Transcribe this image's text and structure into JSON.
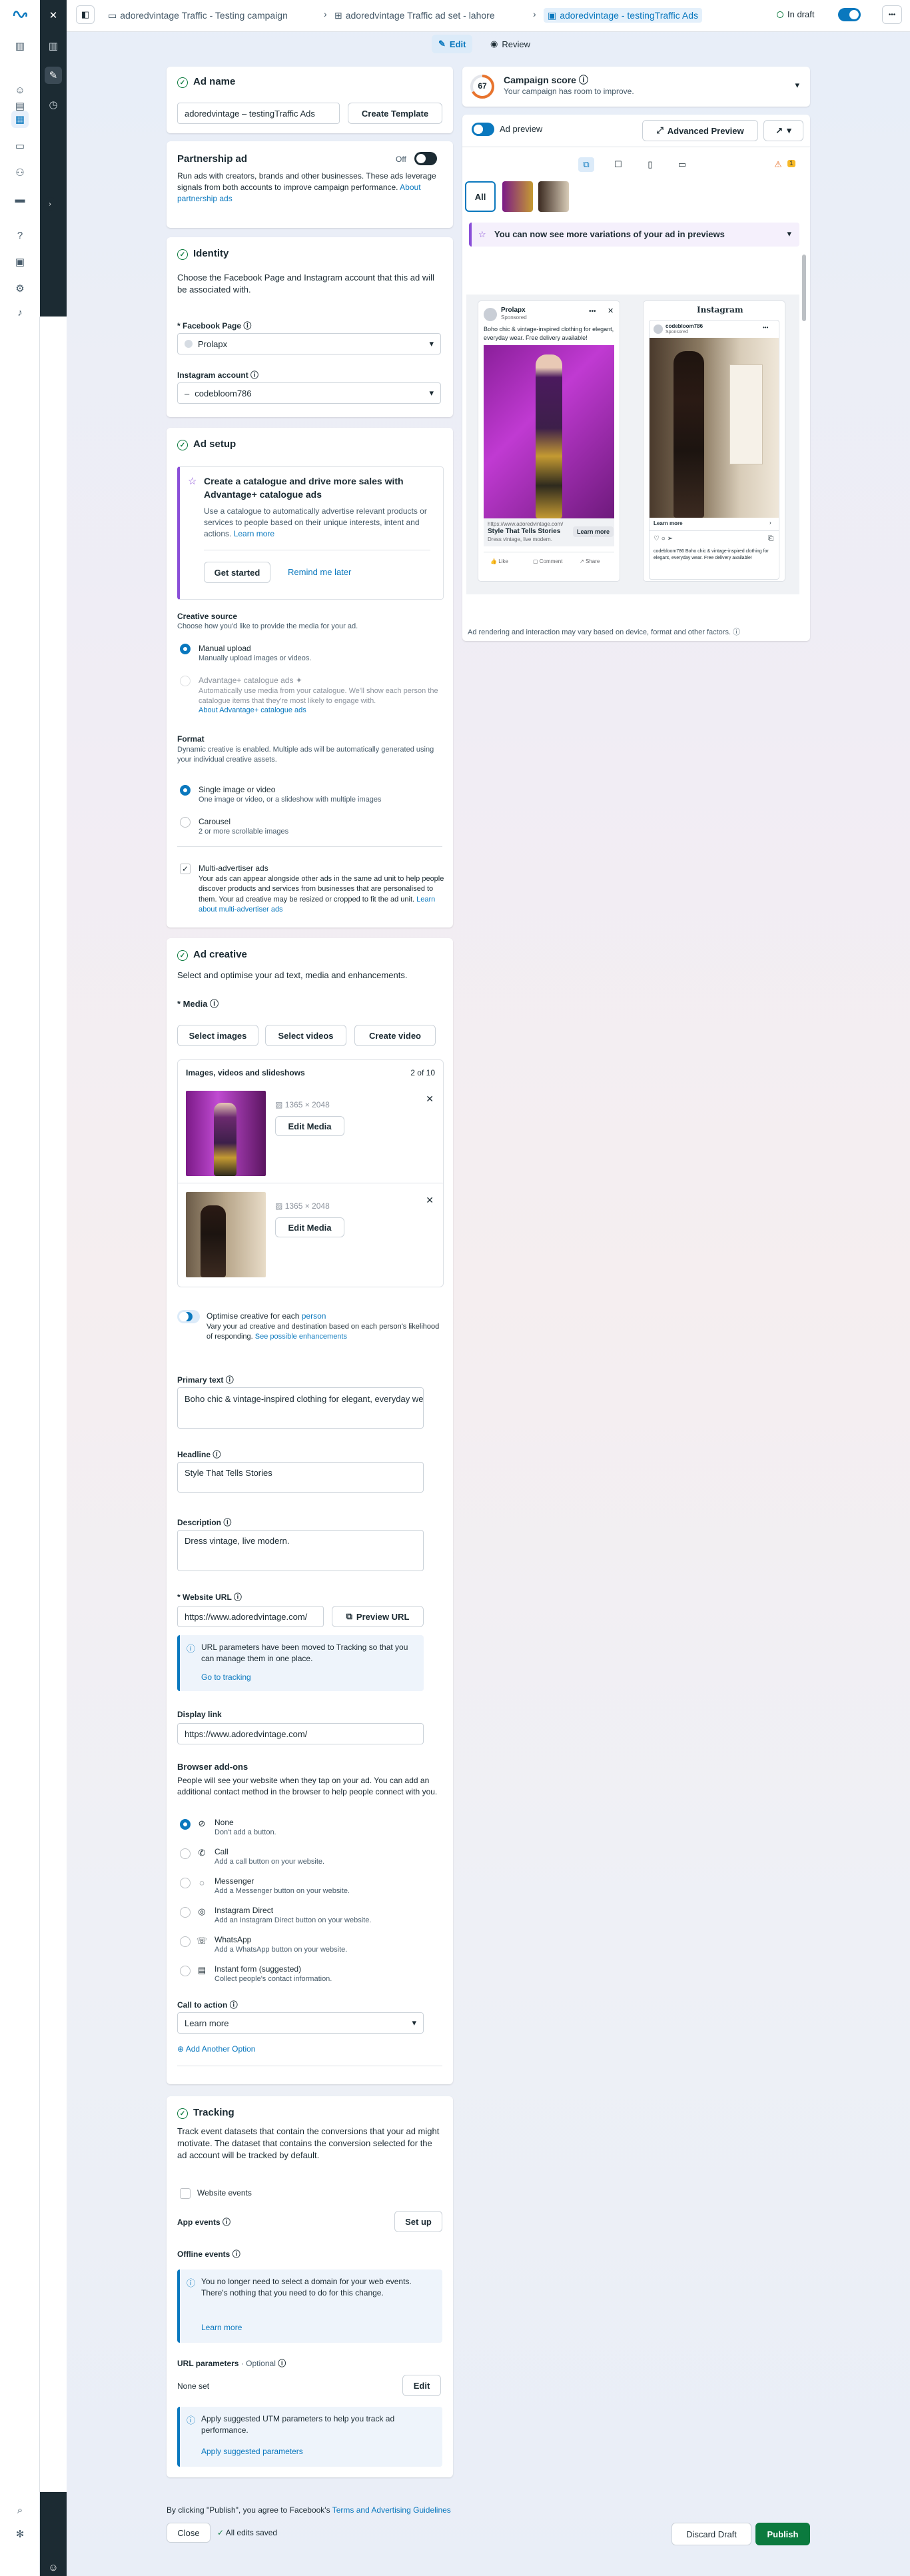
{
  "nav": {
    "icons": [
      "close-icon",
      "chart-icon",
      "smiley-icon",
      "ads-grid-icon",
      "pages-icon",
      "people-icon",
      "billing-icon",
      "expand-icon",
      "help-icon",
      "briefcase-icon",
      "settings-icon",
      "bell-icon",
      "search-icon",
      "bug-icon",
      "edit-icon",
      "clock-icon"
    ]
  },
  "header": {
    "crumb1": "adoredvintage Traffic - Testing campaign",
    "crumb2": "adoredvintage Traffic ad set - lahore",
    "crumb3": "adoredvintage - testingTraffic Ads",
    "status": "In draft",
    "more": "•••"
  },
  "tabs": {
    "edit": "Edit",
    "review": "Review"
  },
  "ad_name": {
    "title": "Ad name",
    "value": "adoredvintage – testingTraffic  Ads",
    "template_btn": "Create Template"
  },
  "partnership": {
    "title": "Partnership ad",
    "state": "Off",
    "desc": "Run ads with creators, brands and other businesses. These ads leverage signals from both accounts to improve campaign performance.",
    "link": "About partnership ads"
  },
  "identity": {
    "title": "Identity",
    "desc": "Choose the Facebook Page and Instagram account that this ad will be associated with.",
    "fb_label": "* Facebook Page",
    "fb_value": "Prolapx",
    "ig_label": "Instagram account",
    "ig_value": "codebloom786"
  },
  "ad_setup": {
    "title": "Ad setup",
    "promo_title": "Create a catalogue and drive more sales with Advantage+ catalogue ads",
    "promo_desc": "Use a catalogue to automatically advertise relevant products or services to people based on their unique interests, intent and actions.",
    "promo_link": "Learn more",
    "get_started": "Get started",
    "remind": "Remind me later",
    "cs_title": "Creative source",
    "cs_desc": "Choose how you'd like to provide the media for your ad.",
    "manual": "Manual upload",
    "manual_desc": "Manually upload images or videos.",
    "catalog": "Advantage+ catalogue ads",
    "catalog_desc": "Automatically use media from your catalogue. We'll show each person the catalogue items that they're most likely to engage with.",
    "catalog_link": "About Advantage+ catalogue ads",
    "format_title": "Format",
    "format_desc": "Dynamic creative is enabled. Multiple ads will be automatically generated using your individual creative assets.",
    "single": "Single image or video",
    "single_desc": "One image or video, or a slideshow with multiple images",
    "carousel": "Carousel",
    "carousel_desc": "2 or more scrollable images",
    "multi": "Multi-advertiser ads",
    "multi_desc": "Your ads can appear alongside other ads in the same ad unit to help people discover products and services from businesses that are personalised to them. Your ad creative may be resized or cropped to fit the ad unit.",
    "multi_link": "Learn about multi-advertiser ads"
  },
  "ad_creative": {
    "title": "Ad creative",
    "desc": "Select and optimise your ad text, media and enhancements.",
    "media_label": "* Media",
    "select_images": "Select images",
    "select_videos": "Select videos",
    "create_video": "Create video",
    "list_title": "Images, videos and slideshows",
    "count": "2 of 10",
    "items": [
      {
        "dims": "1365 × 2048",
        "edit": "Edit Media"
      },
      {
        "dims": "1365 × 2048",
        "edit": "Edit Media"
      }
    ],
    "optimise_prefix": "Optimise creative for each ",
    "optimise_link": "person",
    "optimise_desc": "Vary your ad creative and destination based on each person's likelihood of responding.",
    "optimise_link2": "See possible enhancements",
    "primary_label": "Primary text",
    "primary_value": "Boho chic & vintage-inspired clothing for elegant, everyday wear. Free delivery available!",
    "headline_label": "Headline",
    "headline_value": "Style That Tells Stories",
    "description_label": "Description",
    "description_value": "Dress vintage, live modern.",
    "url_label": "* Website URL",
    "url_value": "https://www.adoredvintage.com/",
    "preview_url": "Preview URL",
    "url_info": "URL parameters have been moved to Tracking so that you can manage them in one place.",
    "go_tracking": "Go to tracking",
    "display_label": "Display link",
    "display_value": "https://www.adoredvintage.com/",
    "addons_title": "Browser add-ons",
    "addons_desc": "People will see your website when they tap on your ad. You can add an additional contact method in the browser to help people connect with you.",
    "addons": [
      {
        "label": "None",
        "desc": "Don't add a button.",
        "icon": "ban-icon"
      },
      {
        "label": "Call",
        "desc": "Add a call button on your website.",
        "icon": "phone-icon"
      },
      {
        "label": "Messenger",
        "desc": "Add a Messenger button on your website.",
        "icon": "messenger-icon"
      },
      {
        "label": "Instagram Direct",
        "desc": "Add an Instagram Direct button on your website.",
        "icon": "instagram-icon"
      },
      {
        "label": "WhatsApp",
        "desc": "Add a WhatsApp button on your website.",
        "icon": "whatsapp-icon"
      },
      {
        "label": "Instant form (suggested)",
        "desc": "Collect people's contact information.",
        "icon": "form-icon"
      }
    ],
    "cta_label": "Call to action",
    "cta_value": "Learn more",
    "add_option": "Add Another Option"
  },
  "tracking": {
    "title": "Tracking",
    "desc": "Track event datasets that contain the conversions that your ad might motivate. The dataset that contains the conversion selected for the ad account will be tracked by default.",
    "website": "Website events",
    "app": "App events",
    "setup": "Set up",
    "offline": "Offline events",
    "offline_info": "You no longer need to select a domain for your web events. There's nothing that you need to do for this change.",
    "learn_more": "Learn more",
    "url_params": "URL parameters",
    "optional": "· Optional",
    "none_set": "None set",
    "edit": "Edit",
    "utm_info": "Apply suggested UTM parameters to help you track ad performance.",
    "apply": "Apply suggested parameters"
  },
  "campaign_score": {
    "value": "67",
    "title": "Campaign score",
    "desc": "Your campaign has room to improve.",
    "progress": 0.67
  },
  "preview": {
    "label": "Ad preview",
    "advanced": "Advanced Preview",
    "all": "All",
    "warn_count": "1",
    "variations": "You can now see more variations of your ad in previews",
    "fb_page": "Prolapx",
    "fb_sponsored": "Sponsored",
    "fb_text": "Boho chic & vintage-inspired clothing for elegant, everyday wear. Free delivery available!",
    "fb_domain": "https://www.adoredvintage.com/",
    "fb_headline": "Style That Tells Stories",
    "fb_desc": "Dress vintage, live modern.",
    "fb_cta": "Learn more",
    "like": "Like",
    "comment": "Comment",
    "share": "Share",
    "ig_logo": "Instagram",
    "ig_user": "codebloom786",
    "ig_sponsored": "Sponsored",
    "ig_cta": "Learn more",
    "ig_caption": "codebloom786 Boho chic & vintage-inspired clothing for elegant, everyday wear. Free delivery available!",
    "footer": "Ad rendering and interaction may vary based on device, format and other factors."
  },
  "footer": {
    "notice_prefix": "By clicking \"Publish\", you agree to Facebook's ",
    "notice_link": "Terms and Advertising Guidelines",
    "close": "Close",
    "saved": "All edits saved",
    "discard": "Discard Draft",
    "publish": "Publish"
  },
  "colors": {
    "accent": "#0a78be",
    "publish": "#0b7a3e",
    "dark": "#1c2b33"
  }
}
